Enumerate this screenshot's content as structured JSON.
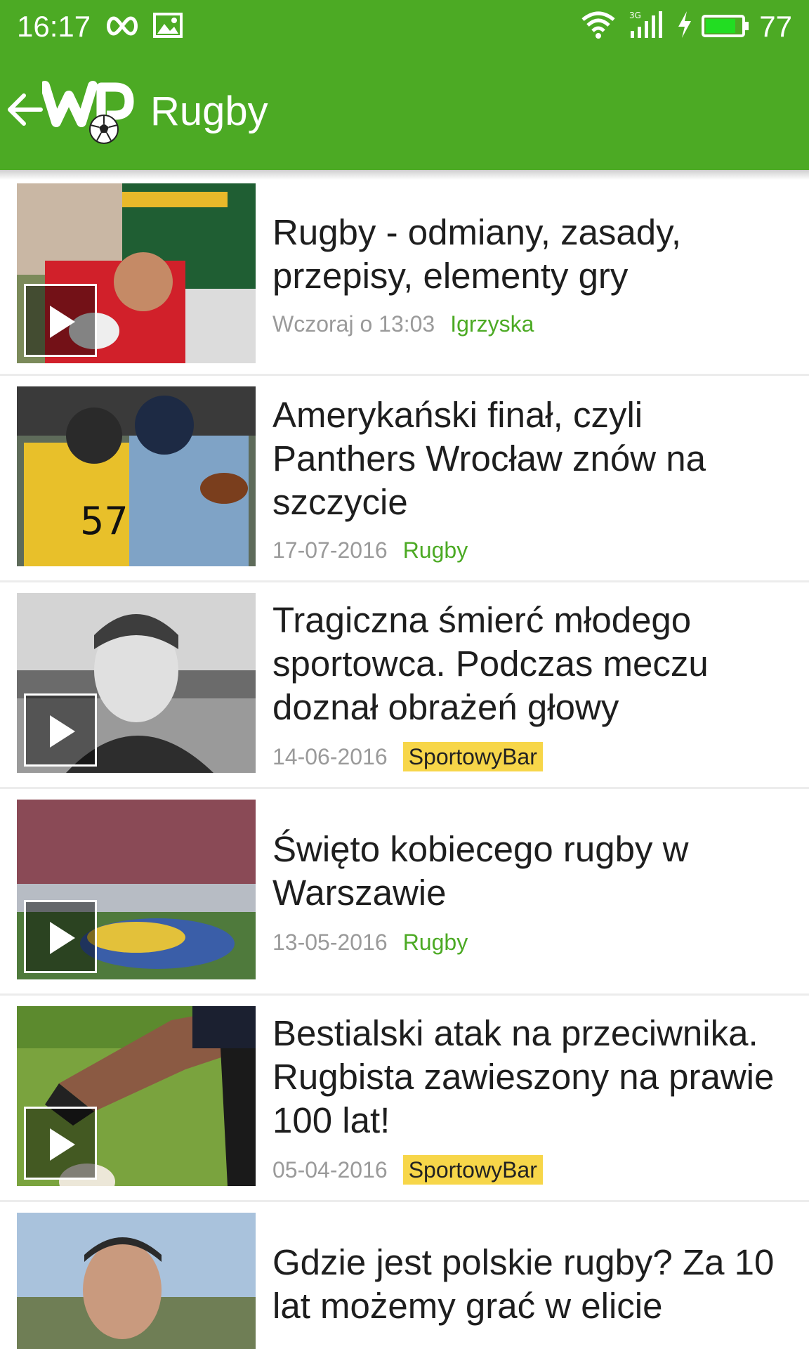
{
  "status_bar": {
    "time": "16:17",
    "battery": "77",
    "network": "3G"
  },
  "toolbar": {
    "title": "Rugby"
  },
  "colors": {
    "brand_green": "#4caa24",
    "category_green": "#4caa24",
    "category_yellow_bg": "#f7d649",
    "date_gray": "#9a9a9a"
  },
  "articles": [
    {
      "title": "Rugby - odmiany, zasady, przepisy, elementy gry",
      "date": "Wczoraj o 13:03",
      "category": "Igrzyska",
      "category_style": "green",
      "video": true
    },
    {
      "title": "Amerykański finał, czyli Panthers Wrocław znów na szczycie",
      "date": "17-07-2016",
      "category": "Rugby",
      "category_style": "green",
      "video": false
    },
    {
      "title": "Tragiczna śmierć młodego sportowca. Podczas meczu doznał obrażeń głowy",
      "date": "14-06-2016",
      "category": "SportowyBar",
      "category_style": "yellow",
      "video": true
    },
    {
      "title": "Święto kobiecego rugby w Warszawie",
      "date": "13-05-2016",
      "category": "Rugby",
      "category_style": "green",
      "video": true
    },
    {
      "title": "Bestialski atak na przeciwnika. Rugbista zawieszony na prawie 100 lat!",
      "date": "05-04-2016",
      "category": "SportowyBar",
      "category_style": "yellow",
      "video": true
    },
    {
      "title": "Gdzie jest polskie rugby? Za 10 lat możemy grać w elicie",
      "date": "",
      "category": "",
      "category_style": "green",
      "video": false
    }
  ]
}
